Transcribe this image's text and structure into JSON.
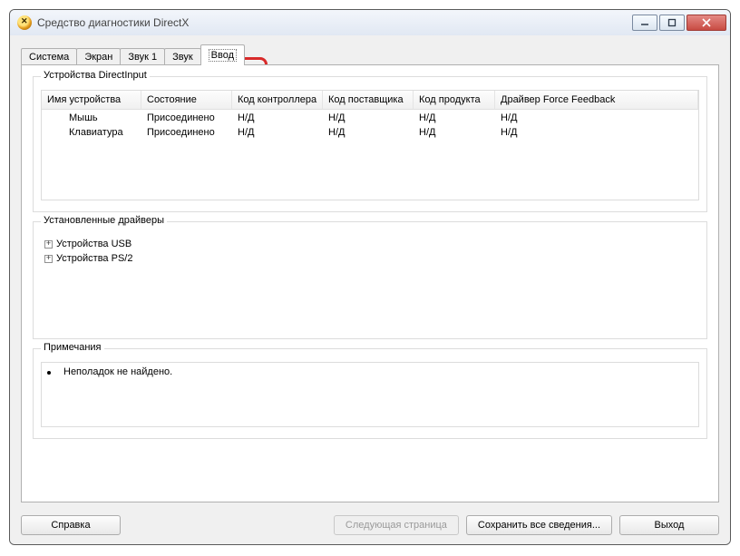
{
  "window": {
    "title": "Средство диагностики DirectX"
  },
  "tabs": [
    "Система",
    "Экран",
    "Звук 1",
    "Звук",
    "Ввод"
  ],
  "active_tab_index": 4,
  "devices_group": {
    "title": "Устройства DirectInput",
    "columns": [
      "Имя устройства",
      "Состояние",
      "Код контроллера",
      "Код поставщика",
      "Код продукта",
      "Драйвер Force Feedback"
    ],
    "rows": [
      {
        "name": "Мышь",
        "state": "Присоединено",
        "controller": "Н/Д",
        "vendor": "Н/Д",
        "product": "Н/Д",
        "ff": "Н/Д"
      },
      {
        "name": "Клавиатура",
        "state": "Присоединено",
        "controller": "Н/Д",
        "vendor": "Н/Д",
        "product": "Н/Д",
        "ff": "Н/Д"
      }
    ]
  },
  "drivers_group": {
    "title": "Установленные драйверы",
    "nodes": [
      "Устройства USB",
      "Устройства PS/2"
    ]
  },
  "notes_group": {
    "title": "Примечания",
    "note": "Неполадок не найдено."
  },
  "buttons": {
    "help": "Справка",
    "next": "Следующая страница",
    "save": "Сохранить все сведения...",
    "exit": "Выход"
  }
}
